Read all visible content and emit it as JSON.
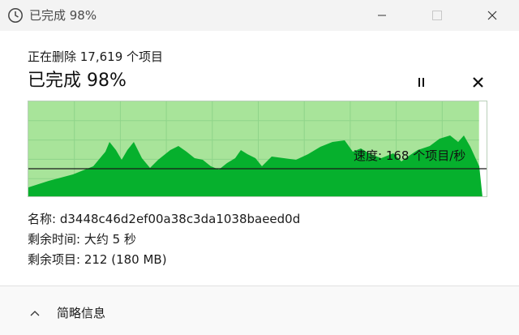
{
  "window": {
    "title": "已完成 98%",
    "icon": "clock-icon",
    "controls": [
      "minimize-icon",
      "maximize-icon",
      "close-icon"
    ]
  },
  "operation": {
    "status": "正在删除 17,619 个项目",
    "progress_text": "已完成 98%",
    "progress_percent": 98,
    "pause_icon": "pause-icon",
    "cancel_icon": "cancel-icon"
  },
  "speed": {
    "label": "速度: 168 个项目/秒"
  },
  "details": {
    "name_label": "名称:",
    "name_value": "d3448c46d2ef00a38c3da1038baeed0d",
    "time_label": "剩余时间:",
    "time_value": "大约 5 秒",
    "items_label": "剩余项目:",
    "items_value": "212 (180 MB)"
  },
  "footer": {
    "toggle_label": "简略信息",
    "toggle_icon": "chevron-up-icon"
  },
  "colors": {
    "graph_fill": "#06b02d",
    "graph_progress_bg": "#a8e49a",
    "graph_grid": "#8fd48a",
    "speed_line": "#1a1a1a"
  }
}
